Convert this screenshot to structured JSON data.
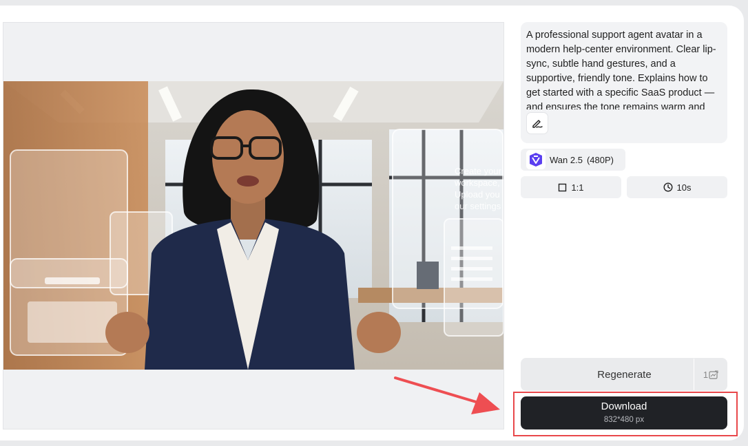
{
  "prompt": {
    "text": "A professional support agent avatar in a modern help-center environment. Clear lip-sync, subtle hand gestures, and a supportive, friendly tone. Explains how to get started with a specific SaaS product — and ensures the tone remains warm and"
  },
  "model": {
    "name": "Wan 2.5",
    "resolution": "(480P)"
  },
  "options": {
    "ratio": "1:1",
    "duration": "10s"
  },
  "actions": {
    "regenerate_label": "Regenerate",
    "regenerate_count": "1",
    "download_label": "Download",
    "download_size": "832*480 px"
  },
  "colors": {
    "download_bg": "#202226",
    "highlight": "#e8474a",
    "panel_bg": "#f2f3f5"
  },
  "icons": [
    "edit-icon",
    "wan-model-logo",
    "square-icon",
    "clock-icon",
    "credit-icon",
    "annotation-arrow"
  ]
}
